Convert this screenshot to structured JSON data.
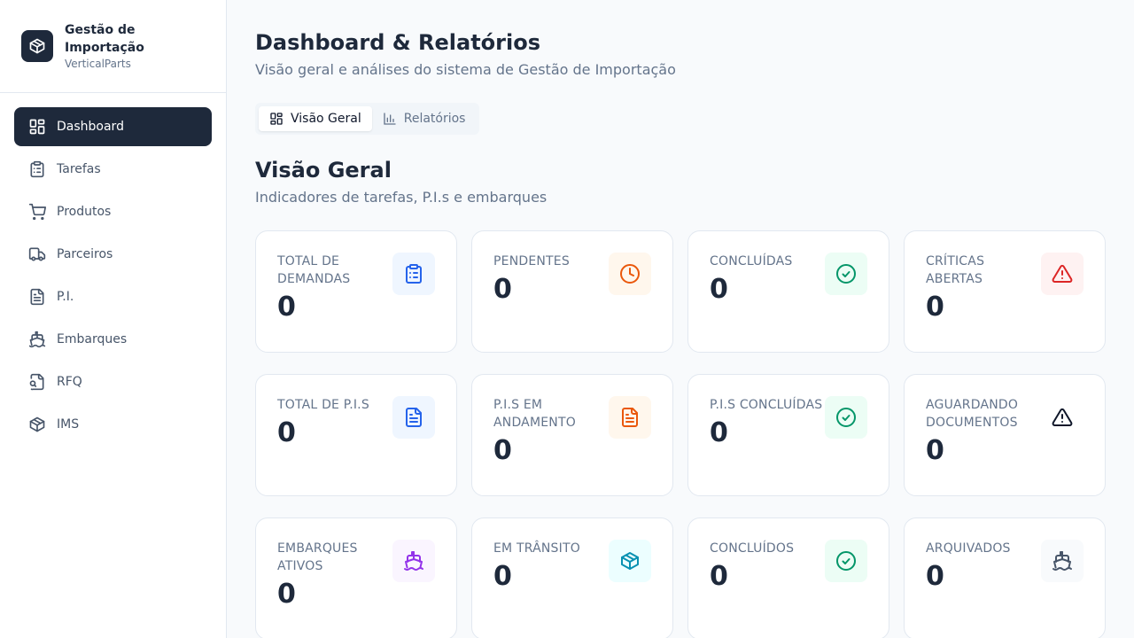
{
  "brand": {
    "title": "Gestão de Importação",
    "subtitle": "VerticalParts",
    "icon": "package-icon"
  },
  "sidebar": {
    "items": [
      {
        "label": "Dashboard",
        "icon": "layout-dashboard-icon",
        "active": true
      },
      {
        "label": "Tarefas",
        "icon": "clipboard-icon",
        "active": false
      },
      {
        "label": "Produtos",
        "icon": "shopping-cart-icon",
        "active": false
      },
      {
        "label": "Parceiros",
        "icon": "truck-icon",
        "active": false
      },
      {
        "label": "P.I.",
        "icon": "file-text-icon",
        "active": false
      },
      {
        "label": "Embarques",
        "icon": "ship-icon",
        "active": false
      },
      {
        "label": "RFQ",
        "icon": "file-search-icon",
        "active": false
      },
      {
        "label": "IMS",
        "icon": "package-icon",
        "active": false
      }
    ]
  },
  "header": {
    "title": "Dashboard & Relatórios",
    "subtitle": "Visão geral e análises do sistema de Gestão de Importação"
  },
  "tabs": [
    {
      "label": "Visão Geral",
      "icon": "layout-dashboard-icon",
      "active": true
    },
    {
      "label": "Relatórios",
      "icon": "bar-chart-icon",
      "active": false
    }
  ],
  "section": {
    "title": "Visão Geral",
    "subtitle": "Indicadores de tarefas, P.I.s e embarques"
  },
  "cards": [
    {
      "label": "Total de Demandas",
      "value": "0",
      "icon": "clipboard-icon",
      "color": "#2563eb",
      "bg": "#eff6ff"
    },
    {
      "label": "Pendentes",
      "value": "0",
      "icon": "clock-icon",
      "color": "#ea580c",
      "bg": "#fff7ed"
    },
    {
      "label": "Concluídas",
      "value": "0",
      "icon": "check-circle-icon",
      "color": "#059669",
      "bg": "#ecfdf5"
    },
    {
      "label": "Críticas Abertas",
      "value": "0",
      "icon": "alert-triangle-icon",
      "color": "#dc2626",
      "bg": "#fef2f2"
    },
    {
      "label": "Total de P.I.s",
      "value": "0",
      "icon": "file-text-icon",
      "color": "#2563eb",
      "bg": "#eff6ff"
    },
    {
      "label": "P.I.s em Andamento",
      "value": "0",
      "icon": "file-text-icon",
      "color": "#ea580c",
      "bg": "#fff7ed"
    },
    {
      "label": "P.I.s Concluídas",
      "value": "0",
      "icon": "check-circle-icon",
      "color": "#059669",
      "bg": "#ecfdf5"
    },
    {
      "label": "Aguardando Documentos",
      "value": "0",
      "icon": "alert-triangle-icon",
      "color": "#0f172a",
      "bg": "#ffffff"
    },
    {
      "label": "Embarques Ativos",
      "value": "0",
      "icon": "ship-icon",
      "color": "#9333ea",
      "bg": "#faf5ff"
    },
    {
      "label": "Em Trânsito",
      "value": "0",
      "icon": "package-icon",
      "color": "#0891b2",
      "bg": "#ecfeff"
    },
    {
      "label": "Concluídos",
      "value": "0",
      "icon": "check-circle-icon",
      "color": "#059669",
      "bg": "#ecfdf5"
    },
    {
      "label": "Arquivados",
      "value": "0",
      "icon": "ship-icon",
      "color": "#475569",
      "bg": "#f8fafc"
    }
  ]
}
